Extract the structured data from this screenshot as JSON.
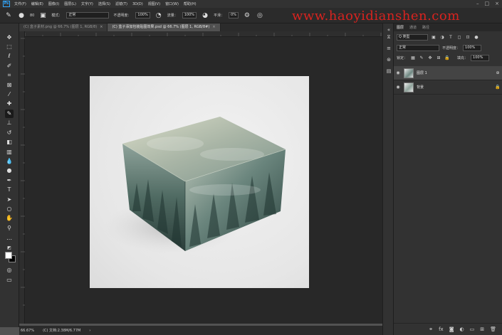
{
  "app": {
    "logo": "Ps"
  },
  "menu": [
    "文件(F)",
    "编辑(E)",
    "图像(I)",
    "图层(L)",
    "文字(Y)",
    "选择(S)",
    "滤镜(T)",
    "3D(D)",
    "视图(V)",
    "窗口(W)",
    "帮助(H)"
  ],
  "options": {
    "brush_size": "80",
    "mode_label": "模式：",
    "mode_value": "正常",
    "opacity_label": "不透明度：",
    "opacity_value": "100%",
    "flow_label": "流量：",
    "flow_value": "100%",
    "smooth_label": "平滑：",
    "smooth_value": "0%"
  },
  "watermark": "www.haoyidianshen.com",
  "tabs": [
    {
      "label": "(C) 盒子素材.png @ 66.7% (图层 1, RGB/8)"
    },
    {
      "label": "(C) 盒子添加包装贴图效果.psd @ 66.7% (图层 1, RGB/8#)"
    }
  ],
  "status": {
    "zoom": "66.67%",
    "info": "(C) 文档:2.38M/6.77M"
  },
  "layers": {
    "tabs": [
      "图层",
      "通道",
      "路径"
    ],
    "search_value": "Q 类型",
    "blend_value": "正常",
    "opacity_label": "不透明度：",
    "opacity_value": "100%",
    "lock_label": "锁定：",
    "fill_label": "填充：",
    "fill_value": "100%",
    "items": [
      {
        "name": "图层 1",
        "selected": true
      },
      {
        "name": "背景",
        "selected": false
      }
    ]
  },
  "colors": {
    "accent": "#31a8ff",
    "watermark": "#d8231f",
    "canvas": "#282828"
  }
}
